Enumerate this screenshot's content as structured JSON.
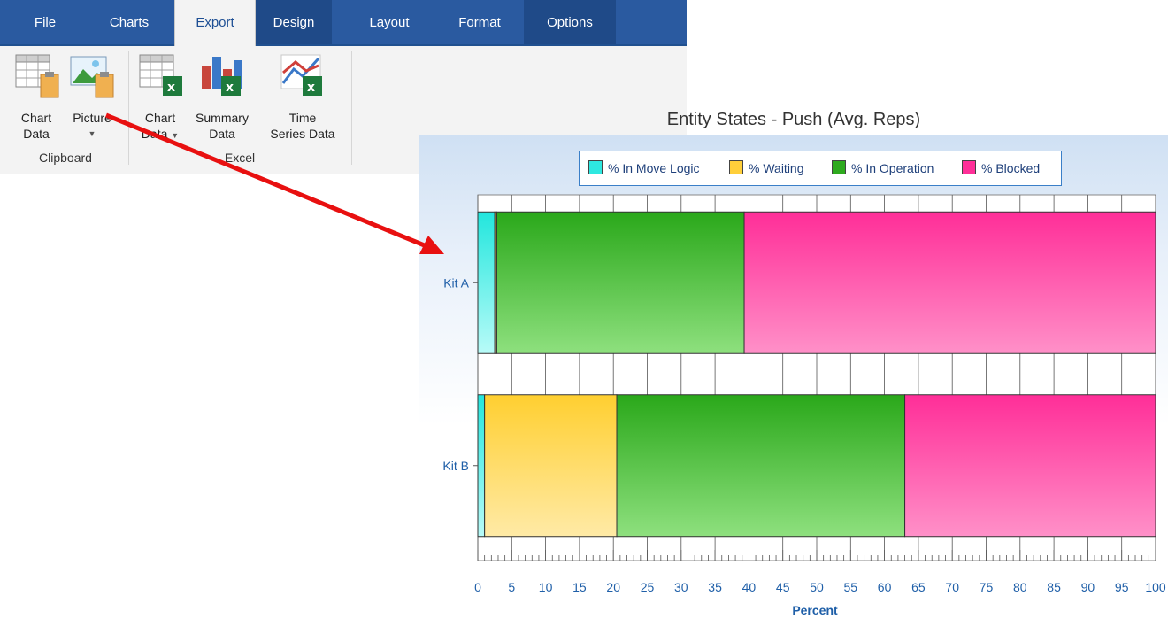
{
  "tabs": [
    {
      "label": "File",
      "active": false
    },
    {
      "label": "Charts",
      "active": false
    },
    {
      "label": "Export",
      "active": true
    },
    {
      "label": "Design",
      "active": false
    },
    {
      "label": "Layout",
      "active": false
    },
    {
      "label": "Format",
      "active": false
    },
    {
      "label": "Options",
      "active": false
    }
  ],
  "ribbon": {
    "clipboard": {
      "group_label": "Clipboard",
      "chart_data_label_1": "Chart",
      "chart_data_label_2": "Data",
      "picture_label": "Picture"
    },
    "excel": {
      "group_label": "Excel",
      "chart_data_label_1": "Chart",
      "chart_data_label_2": "Data",
      "summary_label_1": "Summary",
      "summary_label_2": "Data",
      "time_label_1": "Time",
      "time_label_2": "Series Data"
    }
  },
  "colors": {
    "tab_bar": "#2a5aa0",
    "move_logic": "#2ee8e0",
    "waiting": "#ffcf3a",
    "in_operation": "#2eaa1e",
    "blocked": "#ff2f98",
    "axis_text": "#1f5fa8",
    "arrow": "#e81010"
  },
  "chart_data": {
    "type": "bar",
    "orientation": "horizontal",
    "stacked": true,
    "title": "Entity States - Push (Avg. Reps)",
    "xlabel": "Percent",
    "ylabel": "",
    "xlim": [
      0,
      100
    ],
    "x_ticks": [
      0,
      5,
      10,
      15,
      20,
      25,
      30,
      35,
      40,
      45,
      50,
      55,
      60,
      65,
      70,
      75,
      80,
      85,
      90,
      95,
      100
    ],
    "grid": true,
    "legend_placement": "top-center",
    "categories": [
      "Kit A",
      "Kit B"
    ],
    "series": [
      {
        "name": "% In Move Logic",
        "values": [
          2.5,
          1.0
        ]
      },
      {
        "name": "% Waiting",
        "values": [
          0.3,
          19.5
        ]
      },
      {
        "name": "% In Operation",
        "values": [
          36.5,
          42.5
        ]
      },
      {
        "name": "% Blocked",
        "values": [
          60.7,
          37.0
        ]
      }
    ]
  }
}
